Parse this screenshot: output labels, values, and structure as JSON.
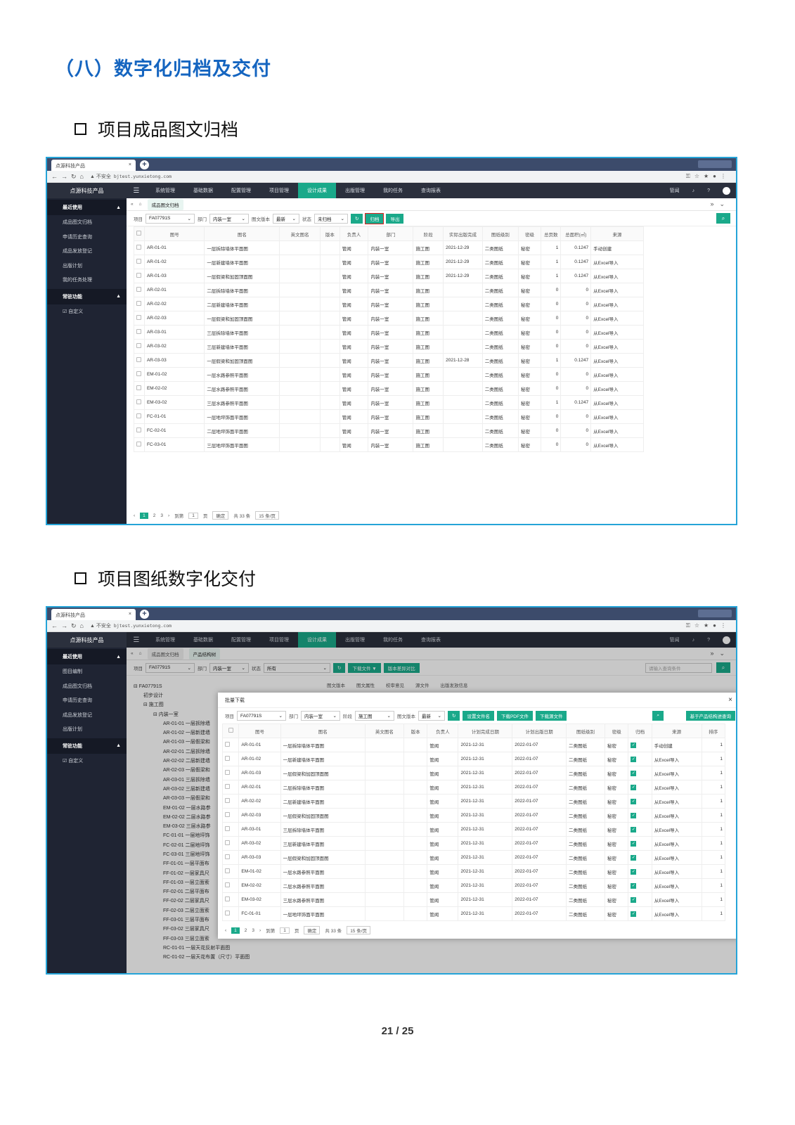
{
  "heading": "（八）数字化归档及交付",
  "section1": "项目成品图文归档",
  "section2": "项目图纸数字化交付",
  "page": "21 / 25",
  "browser": {
    "tab_title": "点源科技产品",
    "insecure": "▲ 不安全",
    "url": "bjtest.yunxietong.com"
  },
  "app": {
    "brand": "点源科技产品",
    "menu": [
      "系统管理",
      "基础数据",
      "配置管理",
      "项目管理",
      "设计成果",
      "出版管理",
      "我的任务",
      "查询报表"
    ],
    "user": "管闻",
    "recent_group": "最近使用",
    "common_group": "常驻功能",
    "custom": "☑ 自定义",
    "accent": "#1aa98a"
  },
  "shot1": {
    "sidebar": [
      "成品图文归档",
      "申请历史查询",
      "成品发放登记",
      "出版计划",
      "我的任务处理"
    ],
    "tab": "成品图文归档",
    "filters": {
      "project_label": "项目",
      "project": "FA07791S",
      "dept_label": "部门",
      "dept": "内装一室",
      "ver_label": "图文版本",
      "ver": "最新",
      "status_label": "状态",
      "status": "未归档"
    },
    "buttons": [
      "归档",
      "导出"
    ],
    "columns": [
      "图号",
      "图名",
      "英文图名",
      "版本",
      "负责人",
      "部门",
      "阶段",
      "实际出版完成",
      "图纸级别",
      "密级",
      "总页数",
      "总面积(㎡)",
      "来源"
    ],
    "rows": [
      [
        "AR-01-01",
        "一层拆除墙体平面图",
        "",
        "",
        "管闻",
        "内装一室",
        "施工图",
        "2021-12-29",
        "二类图纸",
        "秘密",
        "1",
        "0.1247",
        "手动创建"
      ],
      [
        "AR-01-02",
        "一层新建墙体平面图",
        "",
        "",
        "管闻",
        "内装一室",
        "施工图",
        "2021-12-29",
        "二类图纸",
        "秘密",
        "1",
        "0.1247",
        "从Excel导入"
      ],
      [
        "AR-01-03",
        "一层假梁和加固顶面图",
        "",
        "",
        "管闻",
        "内装一室",
        "施工图",
        "2021-12-29",
        "二类图纸",
        "秘密",
        "1",
        "0.1247",
        "从Excel导入"
      ],
      [
        "AR-02-01",
        "二层拆除墙体平面图",
        "",
        "",
        "管闻",
        "内装一室",
        "施工图",
        "",
        "二类图纸",
        "秘密",
        "0",
        "0",
        "从Excel导入"
      ],
      [
        "AR-02-02",
        "二层新建墙体平面图",
        "",
        "",
        "管闻",
        "内装一室",
        "施工图",
        "",
        "二类图纸",
        "秘密",
        "0",
        "0",
        "从Excel导入"
      ],
      [
        "AR-02-03",
        "一层假梁和加固顶面图",
        "",
        "",
        "管闻",
        "内装一室",
        "施工图",
        "",
        "二类图纸",
        "秘密",
        "0",
        "0",
        "从Excel导入"
      ],
      [
        "AR-03-01",
        "三层拆除墙体平面图",
        "",
        "",
        "管闻",
        "内装一室",
        "施工图",
        "",
        "二类图纸",
        "秘密",
        "0",
        "0",
        "从Excel导入"
      ],
      [
        "AR-03-02",
        "三层新建墙体平面图",
        "",
        "",
        "管闻",
        "内装一室",
        "施工图",
        "",
        "二类图纸",
        "秘密",
        "0",
        "0",
        "从Excel导入"
      ],
      [
        "AR-03-03",
        "一层假梁和加固顶面图",
        "",
        "",
        "管闻",
        "内装一室",
        "施工图",
        "2021-12-28",
        "二类图纸",
        "秘密",
        "1",
        "0.1247",
        "从Excel导入"
      ],
      [
        "EM-01-02",
        "一层水路参照平面图",
        "",
        "",
        "管闻",
        "内装一室",
        "施工图",
        "",
        "二类图纸",
        "秘密",
        "0",
        "0",
        "从Excel导入"
      ],
      [
        "EM-02-02",
        "二层水路参照平面图",
        "",
        "",
        "管闻",
        "内装一室",
        "施工图",
        "",
        "二类图纸",
        "秘密",
        "0",
        "0",
        "从Excel导入"
      ],
      [
        "EM-03-02",
        "三层水路参照平面图",
        "",
        "",
        "管闻",
        "内装一室",
        "施工图",
        "",
        "二类图纸",
        "秘密",
        "1",
        "0.1247",
        "从Excel导入"
      ],
      [
        "FC-01-01",
        "一层地坪饰面平面图",
        "",
        "",
        "管闻",
        "内装一室",
        "施工图",
        "",
        "二类图纸",
        "秘密",
        "0",
        "0",
        "从Excel导入"
      ],
      [
        "FC-02-01",
        "二层地坪饰面平面图",
        "",
        "",
        "管闻",
        "内装一室",
        "施工图",
        "",
        "二类图纸",
        "秘密",
        "0",
        "0",
        "从Excel导入"
      ],
      [
        "FC-03-01",
        "三层地坪饰面平面图",
        "",
        "",
        "管闻",
        "内装一室",
        "施工图",
        "",
        "二类图纸",
        "秘密",
        "0",
        "0",
        "从Excel导入"
      ]
    ],
    "pager": {
      "p1": "1",
      "p2": "2",
      "p3": "3",
      "goto": "到第",
      "goto_val": "1",
      "page": "页",
      "ok": "确定",
      "total": "共 33 条",
      "size": "15 条/页"
    }
  },
  "shot2": {
    "sidebar": [
      "图目编制",
      "成品图文归档",
      "申请历史查询",
      "成品发放登记",
      "出版计划"
    ],
    "tabs": [
      "成品图文归档",
      "产品结构树"
    ],
    "filters": {
      "project_label": "项目",
      "project": "FA07791S",
      "dept_label": "部门",
      "dept": "内装一室",
      "status_label": "状态",
      "status": "所有",
      "search_ph": "请输入查询条件"
    },
    "buttons": [
      "下载文件 ▼",
      "版本差异对比"
    ],
    "subtabs": [
      "图文版本",
      "图文属性",
      "校审意见",
      "源文件",
      "出版发放信息"
    ],
    "tree": [
      [
        "0",
        "⊟ FA07791S"
      ],
      [
        "1",
        "初步设计"
      ],
      [
        "1",
        "⊟ 施工图"
      ],
      [
        "2",
        "⊟ 内装一室"
      ],
      [
        "3",
        "AR-01-01  一层拆除墙"
      ],
      [
        "3",
        "AR-01-02  一层新建墙"
      ],
      [
        "3",
        "AR-01-03  一层假梁和"
      ],
      [
        "3",
        "AR-02-01  二层拆除墙"
      ],
      [
        "3",
        "AR-02-02  二层新建墙"
      ],
      [
        "3",
        "AR-02-03  一层假梁和"
      ],
      [
        "3",
        "AR-03-01  三层拆除墙"
      ],
      [
        "3",
        "AR-03-02  三层新建墙"
      ],
      [
        "3",
        "AR-03-03  一层假梁和"
      ],
      [
        "3",
        "EM-01-02  一层水路参"
      ],
      [
        "3",
        "EM-02-02  二层水路参"
      ],
      [
        "3",
        "EM-03-02  三层水路参"
      ],
      [
        "3",
        "FC-01-01  一层地坪饰"
      ],
      [
        "3",
        "FC-02-01  二层地坪饰"
      ],
      [
        "3",
        "FC-03-01  三层地坪饰"
      ],
      [
        "3",
        "FF-01-01  一层平面布"
      ],
      [
        "3",
        "FF-01-02  一层家具尺"
      ],
      [
        "3",
        "FF-01-03  一层立面索"
      ],
      [
        "3",
        "FF-02-01  二层平面布"
      ],
      [
        "3",
        "FF-02-02  二层家具尺"
      ],
      [
        "3",
        "FF-02-03  二层立面索"
      ],
      [
        "3",
        "FF-03-01  三层平面布"
      ],
      [
        "3",
        "FF-03-02  三层家具尺"
      ],
      [
        "3",
        "FF-03-03  三层立面索"
      ],
      [
        "3",
        "RC-01-01  一层天花反射平面图"
      ],
      [
        "3",
        "RC-01-02  一层天花布置（尺寸）平面图"
      ]
    ],
    "modal": {
      "title": "批量下载",
      "filters": {
        "project_label": "项目",
        "project": "FA07791S",
        "dept_label": "部门",
        "dept": "内装一室",
        "stage_label": "阶段",
        "stage": "施工图",
        "ver_label": "图文版本",
        "ver": "最新"
      },
      "buttons": [
        "设置文件名",
        "下载PDF文件",
        "下载源文件"
      ],
      "query_btn": "基于产品结构进查询",
      "columns": [
        "图号",
        "图名",
        "英文图名",
        "版本",
        "负责人",
        "计划完成日期",
        "计划出版日期",
        "图纸级别",
        "密级",
        "归档",
        "来源",
        "排序"
      ],
      "rows": [
        [
          "AR-01-01",
          "一层拆除墙体平面图",
          "",
          "",
          "管闻",
          "2021-12-31",
          "2022-01-07",
          "二类图纸",
          "秘密",
          "手动创建",
          "1"
        ],
        [
          "AR-01-02",
          "一层新建墙体平面图",
          "",
          "",
          "管闻",
          "2021-12-31",
          "2022-01-07",
          "二类图纸",
          "秘密",
          "从Excel导入",
          "1"
        ],
        [
          "AR-01-03",
          "一层假梁和加固顶面图",
          "",
          "",
          "管闻",
          "2021-12-31",
          "2022-01-07",
          "二类图纸",
          "秘密",
          "从Excel导入",
          "1"
        ],
        [
          "AR-02-01",
          "二层拆除墙体平面图",
          "",
          "",
          "管闻",
          "2021-12-31",
          "2022-01-07",
          "二类图纸",
          "秘密",
          "从Excel导入",
          "1"
        ],
        [
          "AR-02-02",
          "二层新建墙体平面图",
          "",
          "",
          "管闻",
          "2021-12-31",
          "2022-01-07",
          "二类图纸",
          "秘密",
          "从Excel导入",
          "1"
        ],
        [
          "AR-02-03",
          "一层假梁和加固顶面图",
          "",
          "",
          "管闻",
          "2021-12-31",
          "2022-01-07",
          "二类图纸",
          "秘密",
          "从Excel导入",
          "1"
        ],
        [
          "AR-03-01",
          "三层拆除墙体平面图",
          "",
          "",
          "管闻",
          "2021-12-31",
          "2022-01-07",
          "二类图纸",
          "秘密",
          "从Excel导入",
          "1"
        ],
        [
          "AR-03-02",
          "三层新建墙体平面图",
          "",
          "",
          "管闻",
          "2021-12-31",
          "2022-01-07",
          "二类图纸",
          "秘密",
          "从Excel导入",
          "1"
        ],
        [
          "AR-03-03",
          "一层假梁和加固顶面图",
          "",
          "",
          "管闻",
          "2021-12-31",
          "2022-01-07",
          "二类图纸",
          "秘密",
          "从Excel导入",
          "1"
        ],
        [
          "EM-01-02",
          "一层水路参照平面图",
          "",
          "",
          "管闻",
          "2021-12-31",
          "2022-01-07",
          "二类图纸",
          "秘密",
          "从Excel导入",
          "1"
        ],
        [
          "EM-02-02",
          "二层水路参照平面图",
          "",
          "",
          "管闻",
          "2021-12-31",
          "2022-01-07",
          "二类图纸",
          "秘密",
          "从Excel导入",
          "1"
        ],
        [
          "EM-03-02",
          "三层水路参照平面图",
          "",
          "",
          "管闻",
          "2021-12-31",
          "2022-01-07",
          "二类图纸",
          "秘密",
          "从Excel导入",
          "1"
        ],
        [
          "FC-01-01",
          "一层地坪饰面平面图",
          "",
          "",
          "管闻",
          "2021-12-31",
          "2022-01-07",
          "二类图纸",
          "秘密",
          "从Excel导入",
          "1"
        ]
      ],
      "pager": {
        "p1": "1",
        "p2": "2",
        "p3": "3",
        "goto": "到第",
        "goto_val": "1",
        "page": "页",
        "ok": "确定",
        "total": "共 33 条",
        "size": "15 条/页"
      }
    }
  }
}
